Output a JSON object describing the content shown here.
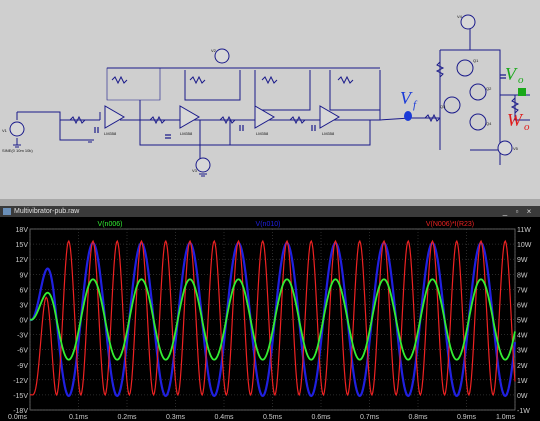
{
  "window": {
    "title": "Multivibrator-pub.raw",
    "minimize_glyph": "_",
    "restore_glyph": "▫",
    "close_glyph": "×"
  },
  "schematic": {
    "annotations": {
      "vf": "V",
      "vf_sub": "f",
      "vo": "V",
      "vo_sub": "o",
      "wo": "W",
      "wo_sub": "o"
    },
    "components": [
      {
        "id": "V1",
        "label": "V1"
      },
      {
        "id": "V2",
        "label": "V2"
      },
      {
        "id": "V3",
        "label": "V3"
      },
      {
        "id": "V4",
        "label": "V4"
      },
      {
        "id": "V5",
        "label": "V5"
      },
      {
        "id": "U1",
        "label": "LM358"
      },
      {
        "id": "U2",
        "label": "LM358"
      },
      {
        "id": "U3",
        "label": "LM358"
      },
      {
        "id": "U4",
        "label": "LM358"
      },
      {
        "id": "Q1",
        "label": "Q1"
      },
      {
        "id": "Q2",
        "label": "Q2"
      },
      {
        "id": "Q3",
        "label": "Q3"
      },
      {
        "id": "Q4",
        "label": "Q4"
      }
    ],
    "source_label": "SINE(0 10m 10k)",
    "colors": {
      "wire": "#1a1a8a",
      "annotation_blue": "#1a3ad8",
      "annotation_green": "#1aa81a",
      "annotation_red": "#e01a1a"
    }
  },
  "chart_data": {
    "type": "line",
    "xlabel": "",
    "x_ticks": [
      "0.0ms",
      "0.1ms",
      "0.2ms",
      "0.3ms",
      "0.4ms",
      "0.5ms",
      "0.6ms",
      "0.7ms",
      "0.8ms",
      "0.9ms",
      "1.0ms"
    ],
    "y_left_ticks": [
      "18V",
      "15V",
      "12V",
      "9V",
      "6V",
      "3V",
      "0V",
      "-3V",
      "-6V",
      "-9V",
      "-12V",
      "-15V",
      "-18V"
    ],
    "y_right_ticks": [
      "11W",
      "10W",
      "9W",
      "8W",
      "7W",
      "6W",
      "5W",
      "4W",
      "3W",
      "2W",
      "1W",
      "0W",
      "-1W"
    ],
    "ylim_left": [
      -18,
      18
    ],
    "ylim_right": [
      -1,
      11
    ],
    "xlim_ms": [
      0,
      1.0
    ],
    "grid": true,
    "series": [
      {
        "name": "V(n006)",
        "color": "#33ee33",
        "axis": "left",
        "amplitude": 8.0,
        "unit": "V"
      },
      {
        "name": "V(n010)",
        "color": "#2020e0",
        "axis": "left",
        "amplitude": 15.2,
        "unit": "V"
      },
      {
        "name": "V(N006)*I(R23)",
        "color": "#ee2222",
        "axis": "right",
        "peak": 10.2,
        "unit": "W"
      }
    ],
    "frequency_khz": 10,
    "background": "#000000",
    "grid_color": "#555555",
    "tick_color": "#cccccc"
  }
}
